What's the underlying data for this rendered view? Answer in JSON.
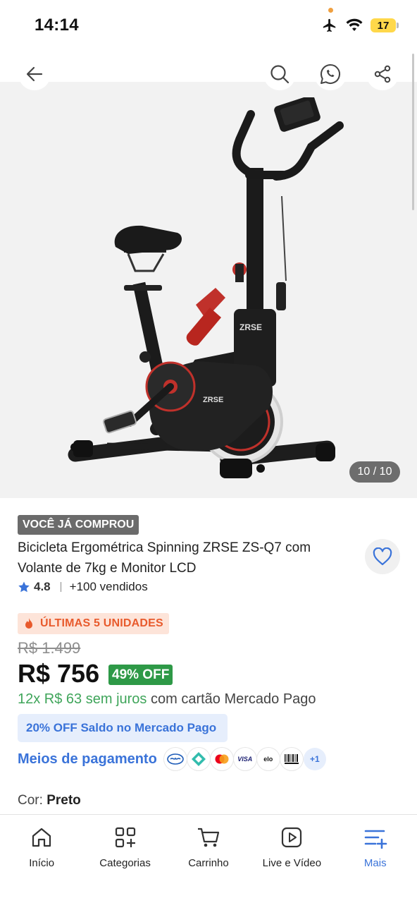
{
  "status_bar": {
    "time": "14:14",
    "battery": "17"
  },
  "header": {
    "back_icon": "arrow-left-icon",
    "search_icon": "search-icon",
    "whatsapp_icon": "whatsapp-share-icon",
    "share_icon": "share-icon"
  },
  "gallery": {
    "counter": "10 / 10"
  },
  "product": {
    "badge": "VOCÊ JÁ COMPROU",
    "title": "Bicicleta Ergométrica Spinning ZRSE ZS-Q7 com Volante de 7kg e Monitor LCD",
    "rating": "4.8",
    "sold": "+100 vendidos",
    "stock": "ÚLTIMAS 5 UNIDADES",
    "old_price": "R$ 1.499",
    "price": "R$ 756",
    "discount": "49% OFF",
    "installment_green": "12x R$ 63 sem juros",
    "installment_rest": " com cartão Mercado Pago",
    "promo": "20% OFF Saldo no Mercado Pago",
    "payment_link": "Meios de pagamento",
    "payment_more": "+1",
    "color_label": "Cor: ",
    "color_value": "Preto"
  },
  "bottom_nav": [
    {
      "label": "Início",
      "icon": "home-icon"
    },
    {
      "label": "Categorias",
      "icon": "grid-plus-icon"
    },
    {
      "label": "Carrinho",
      "icon": "cart-icon"
    },
    {
      "label": "Live e Vídeo",
      "icon": "play-icon"
    },
    {
      "label": "Mais",
      "icon": "menu-plus-icon"
    }
  ],
  "colors": {
    "accent": "#3a73d9",
    "green": "#2e9947",
    "stock_orange": "#e85a2c"
  }
}
